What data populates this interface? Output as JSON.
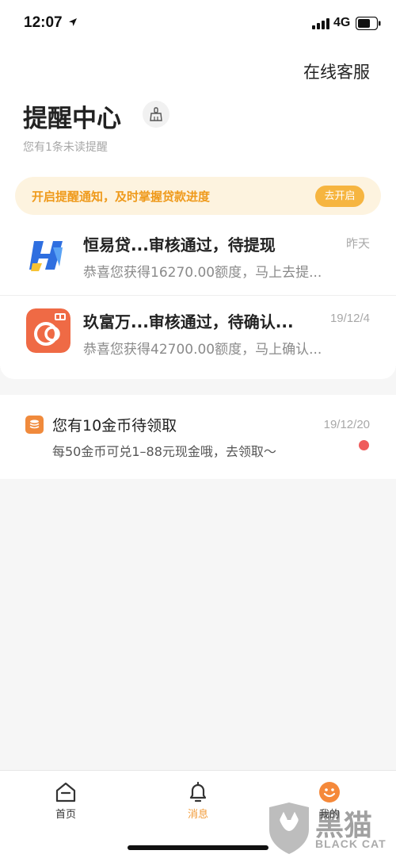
{
  "status_bar": {
    "time": "12:07",
    "network": "4G"
  },
  "header": {
    "online_service": "在线客服",
    "title": "提醒中心",
    "unread_hint": "您有1条未读提醒"
  },
  "notice": {
    "text": "开启提醒通知，及时掌握贷款进度",
    "button": "去开启"
  },
  "messages": [
    {
      "title": "恒易贷...审核通过，待提现",
      "desc": "恭喜您获得16270.00额度，马上去提...",
      "time": "昨天"
    },
    {
      "title": "玖富万...审核通过，待确认...",
      "desc": "恭喜您获得42700.00额度，马上确认...",
      "time": "19/12/4"
    }
  ],
  "coin": {
    "title": "您有10金币待领取",
    "desc": "每50金币可兑1–88元现金哦，去领取～",
    "time": "19/12/20"
  },
  "tabs": [
    {
      "label": "首页",
      "icon": "home-icon"
    },
    {
      "label": "消息",
      "icon": "bell-icon",
      "active": true
    },
    {
      "label": "我的",
      "icon": "smiley-icon"
    }
  ],
  "watermark": {
    "hanzi": "黑猫",
    "text": "BLACK CAT"
  },
  "colors": {
    "accent": "#f29b38",
    "notice_bg": "#fdf3df",
    "unread_dot": "#ef5b5b"
  }
}
